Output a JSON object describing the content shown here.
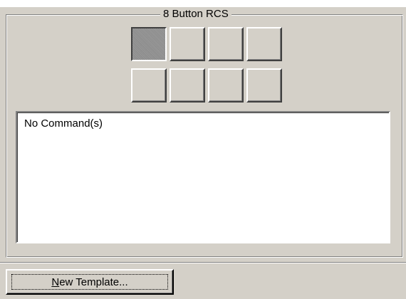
{
  "group": {
    "title": "8 Button RCS"
  },
  "rcs_buttons": {
    "row1": [
      {
        "id": 1,
        "selected": true
      },
      {
        "id": 2,
        "selected": false
      },
      {
        "id": 3,
        "selected": false
      },
      {
        "id": 4,
        "selected": false
      }
    ],
    "row2": [
      {
        "id": 5,
        "selected": false
      },
      {
        "id": 6,
        "selected": false
      },
      {
        "id": 7,
        "selected": false
      },
      {
        "id": 8,
        "selected": false
      }
    ]
  },
  "command_list": {
    "items": [
      "No Command(s)"
    ]
  },
  "new_template_button": {
    "accel": "N",
    "label_rest": "ew Template..."
  },
  "colors": {
    "face": "#d4d0c8",
    "selected": "#8a8a8a"
  }
}
